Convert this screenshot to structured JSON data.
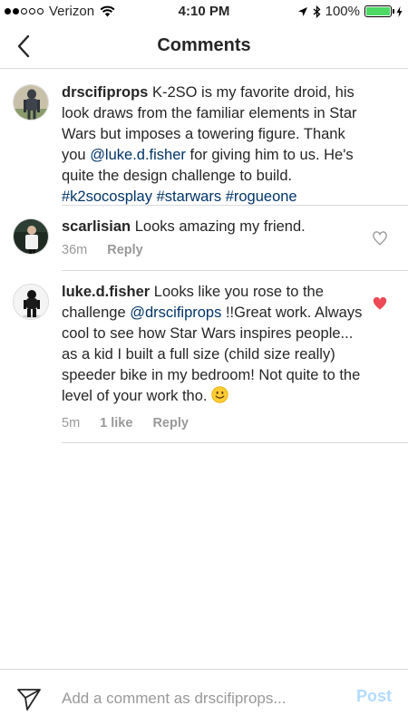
{
  "status_bar": {
    "carrier": "Verizon",
    "time": "4:10 PM",
    "battery": "100%",
    "battery_level": 1.0,
    "signal_bars": 2,
    "icons": [
      "signal-dots-icon",
      "wifi-icon",
      "location-arrow-icon",
      "bluetooth-icon",
      "battery-icon",
      "charging-bolt-icon"
    ]
  },
  "nav": {
    "title": "Comments",
    "back_icon": "chevron-left-icon"
  },
  "comments": [
    {
      "username": "drscifiprops",
      "text_parts": [
        {
          "t": "K-2SO is my favorite droid, his look draws from the familiar elements in Star Wars but imposes a towering figure. Thank you ",
          "link": false
        },
        {
          "t": "@luke.d.fisher",
          "link": true
        },
        {
          "t": " for giving him to us. He's quite the design challenge to build. ",
          "link": false
        },
        {
          "t": "#k2socosplay",
          "link": true
        },
        {
          "t": " ",
          "link": false
        },
        {
          "t": "#starwars",
          "link": true
        },
        {
          "t": " ",
          "link": false
        },
        {
          "t": "#rogueone",
          "link": true
        }
      ],
      "is_caption": true
    },
    {
      "username": "scarlisian",
      "text_parts": [
        {
          "t": "Looks amazing my friend.",
          "link": false
        }
      ],
      "time": "36m",
      "reply": "Reply",
      "liked": false
    },
    {
      "username": "luke.d.fisher",
      "text_parts": [
        {
          "t": "Looks like you rose to the challenge ",
          "link": false
        },
        {
          "t": "@drscifiprops",
          "link": true
        },
        {
          "t": " !!Great work. Always cool to see how Star Wars inspires people... as a kid I built a full size (child size really) speeder bike in my bedroom! Not quite to the level of your work tho. ",
          "link": false
        }
      ],
      "emoji": "slightly-smiling-face-icon",
      "time": "5m",
      "likes": "1 like",
      "reply": "Reply",
      "liked": true
    }
  ],
  "input_bar": {
    "placeholder": "Add a comment as drscifiprops...",
    "post_label": "Post",
    "send_icon": "paper-plane-icon"
  },
  "colors": {
    "link": "#003569",
    "meta": "#999999",
    "heart_liked": "#ed4956",
    "post_disabled": "#b3dbff",
    "battery": "#4cd964"
  }
}
